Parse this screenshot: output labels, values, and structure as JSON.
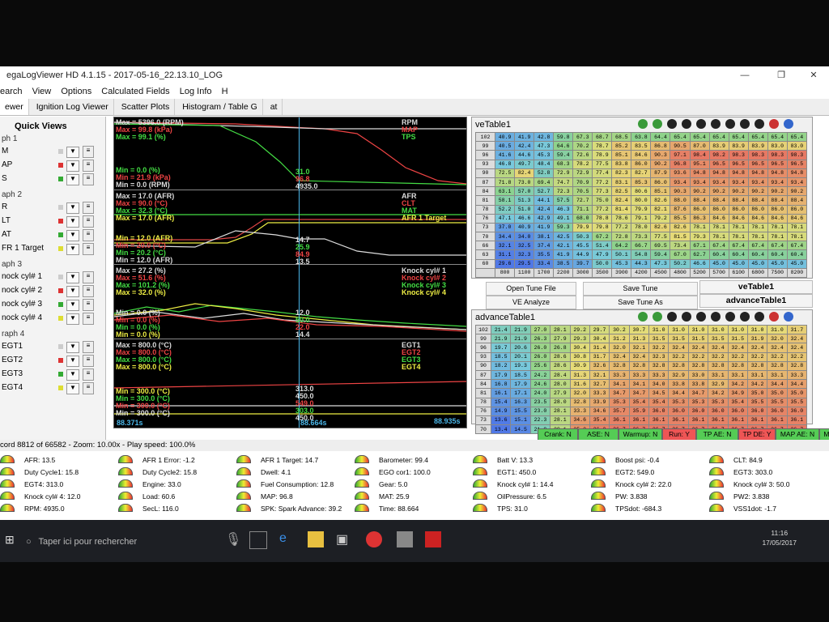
{
  "window": {
    "title": "egaLogViewer HD 4.1.15 - 2017-05-16_22.13.10_LOG",
    "min": "—",
    "max": "❐",
    "close": "✕"
  },
  "menu": [
    "earch",
    "View",
    "Options",
    "Calculated Fields",
    "Log Info",
    "H"
  ],
  "tabs": [
    "ewer",
    "Ignition Log Viewer",
    "Scatter Plots",
    "Histogram / Table G",
    "at"
  ],
  "quickviews": {
    "title": "Quick Views",
    "groups": [
      {
        "label": "ph 1",
        "items": [
          {
            "label": "M",
            "color": "#cccccc"
          },
          {
            "label": "AP",
            "color": "#dd3333"
          },
          {
            "label": "S",
            "color": "#33aa33"
          }
        ]
      },
      {
        "label": "aph 2",
        "items": [
          {
            "label": "R",
            "color": "#cccccc"
          },
          {
            "label": "LT",
            "color": "#dd3333"
          },
          {
            "label": "AT",
            "color": "#33aa33"
          },
          {
            "label": "FR 1 Target",
            "color": "#dddd33"
          }
        ]
      },
      {
        "label": "aph 3",
        "items": [
          {
            "label": "nock cyl# 1",
            "color": "#cccccc"
          },
          {
            "label": "nock cyl# 2",
            "color": "#dd3333"
          },
          {
            "label": "nock cyl# 3",
            "color": "#33aa33"
          },
          {
            "label": "nock cyl# 4",
            "color": "#dddd33"
          }
        ]
      },
      {
        "label": "raph 4",
        "items": [
          {
            "label": "EGT1",
            "color": "#cccccc"
          },
          {
            "label": "EGT2",
            "color": "#dd3333"
          },
          {
            "label": "EGT3",
            "color": "#33aa33"
          },
          {
            "label": "EGT4",
            "color": "#dddd33"
          }
        ]
      }
    ]
  },
  "graph": {
    "p1": {
      "max": [
        "Max = 5396.0 (RPM)",
        "Max = 99.8 (kPa)",
        "Max = 99.1 (%)"
      ],
      "min": [
        "Min = 0.0 (%)",
        "Min = 21.9 (kPa)",
        "Min = 0.0 (RPM)"
      ],
      "legend": [
        "RPM",
        "MAP",
        "TPS"
      ],
      "cursor": [
        "31.0",
        "96.8",
        "4935.0"
      ]
    },
    "p2": {
      "max": [
        "Max = 17.0 (AFR)",
        "Max = 90.0 (°C)",
        "Max = 32.3 (°C)",
        "Max = 17.0 (AFR)"
      ],
      "min": [
        "Min = 12.0 (AFR)",
        "Min = 20.0 (°C)",
        "Min = 20.2 (°C)",
        "Min = 12.0 (AFR)"
      ],
      "legend": [
        "AFR",
        "CLT",
        "MAT",
        "AFR 1 Target"
      ],
      "cursor": [
        "14.7",
        "25.9",
        "84.9",
        "13.5"
      ]
    },
    "p3": {
      "max": [
        "Max = 27.2 (%)",
        "Max = 51.6 (%)",
        "Max = 101.2 (%)",
        "Max = 32.0 (%)"
      ],
      "min": [
        "Min = 0.0 (%)",
        "Min = 0.0 (%)",
        "Min = 0.0 (%)",
        "Min = 0.0 (%)"
      ],
      "legend": [
        "Knock cyl# 1",
        "Knock cyl# 2",
        "Knock cyl# 3",
        "Knock cyl# 4"
      ],
      "cursor": [
        "12.0",
        "50.0",
        "22.0",
        "14.4"
      ]
    },
    "p4": {
      "max": [
        "Max = 800.0 (°C)",
        "Max = 800.0 (°C)",
        "Max = 800.0 (°C)",
        "Max = 800.0 (°C)"
      ],
      "min": [
        "Min = 300.0 (°C)",
        "Min = 300.0 (°C)",
        "Min = 300.0 (°C)",
        "Min = 300.0 (°C)"
      ],
      "legend": [
        "EGT1",
        "EGT2",
        "EGT3",
        "EGT4"
      ],
      "cursor": [
        "313.0",
        "450.0",
        "549.0",
        "303.0",
        "450.0"
      ]
    },
    "time_left": "88.371s",
    "time_cursor": "88.664s",
    "time_right": "88.935s"
  },
  "veTable": {
    "title": "veTable1",
    "rows": [
      "102",
      "99",
      "96",
      "93",
      "90",
      "87",
      "84",
      "81",
      "78",
      "76",
      "73",
      "70",
      "66",
      "63",
      "60"
    ],
    "cols": [
      "800",
      "1100",
      "1700",
      "2200",
      "3000",
      "3500",
      "3900",
      "4200",
      "4500",
      "4800",
      "5200",
      "5700",
      "6100",
      "6800",
      "7500",
      "8200"
    ],
    "cells": [
      [
        "40.9",
        "41.9",
        "42.8",
        "59.8",
        "67.3",
        "68.7",
        "68.5",
        "63.8",
        "64.4",
        "65.4",
        "65.4",
        "65.4",
        "65.4",
        "65.4",
        "65.4",
        "65.4"
      ],
      [
        "40.5",
        "42.4",
        "47.3",
        "64.6",
        "70.2",
        "78.7",
        "85.2",
        "83.5",
        "86.8",
        "90.5",
        "87.0",
        "83.9",
        "83.9",
        "83.9",
        "83.0",
        "83.0"
      ],
      [
        "41.6",
        "44.6",
        "45.3",
        "59.4",
        "72.6",
        "78.9",
        "85.1",
        "84.6",
        "90.3",
        "97.1",
        "98.4",
        "98.2",
        "98.3",
        "98.3",
        "98.3",
        "98.3"
      ],
      [
        "46.8",
        "49.7",
        "48.4",
        "68.3",
        "78.2",
        "77.5",
        "83.8",
        "86.0",
        "90.2",
        "96.8",
        "95.1",
        "96.5",
        "96.5",
        "96.5",
        "96.5",
        "96.5"
      ],
      [
        "72.5",
        "82.4",
        "52.8",
        "72.9",
        "72.9",
        "77.4",
        "82.3",
        "82.7",
        "87.9",
        "93.6",
        "94.8",
        "94.8",
        "94.8",
        "94.8",
        "94.8",
        "94.8"
      ],
      [
        "71.8",
        "73.0",
        "69.4",
        "74.7",
        "70.9",
        "77.2",
        "83.1",
        "85.3",
        "86.0",
        "93.4",
        "93.4",
        "93.4",
        "93.4",
        "93.4",
        "93.4",
        "93.4"
      ],
      [
        "63.1",
        "57.0",
        "52.7",
        "72.3",
        "70.5",
        "77.3",
        "82.5",
        "80.6",
        "85.1",
        "90.3",
        "90.2",
        "90.2",
        "90.2",
        "90.2",
        "90.2",
        "90.2"
      ],
      [
        "58.1",
        "51.3",
        "44.1",
        "57.5",
        "72.7",
        "75.0",
        "82.4",
        "80.0",
        "82.6",
        "88.0",
        "88.4",
        "88.4",
        "88.4",
        "88.4",
        "88.4",
        "88.4"
      ],
      [
        "52.2",
        "51.0",
        "42.4",
        "46.3",
        "71.1",
        "77.2",
        "81.4",
        "79.9",
        "82.1",
        "87.6",
        "86.0",
        "86.0",
        "86.0",
        "86.0",
        "86.0",
        "86.0"
      ],
      [
        "47.1",
        "46.6",
        "42.9",
        "49.1",
        "68.0",
        "78.8",
        "78.6",
        "79.1",
        "79.2",
        "85.5",
        "86.3",
        "84.6",
        "84.6",
        "84.6",
        "84.6",
        "84.6"
      ],
      [
        "37.0",
        "40.9",
        "41.9",
        "59.3",
        "79.9",
        "79.8",
        "77.2",
        "78.0",
        "82.6",
        "82.6",
        "78.1",
        "78.1",
        "78.1",
        "78.1",
        "78.1",
        "78.1"
      ],
      [
        "34.4",
        "34.0",
        "38.1",
        "42.5",
        "50.3",
        "67.2",
        "72.8",
        "73.3",
        "77.5",
        "81.5",
        "79.3",
        "78.1",
        "78.1",
        "78.1",
        "78.1",
        "78.1"
      ],
      [
        "32.1",
        "32.5",
        "37.4",
        "42.1",
        "45.5",
        "51.4",
        "64.2",
        "66.7",
        "69.5",
        "73.4",
        "67.1",
        "67.4",
        "67.4",
        "67.4",
        "67.4",
        "67.4"
      ],
      [
        "31.1",
        "32.3",
        "35.5",
        "41.9",
        "44.9",
        "47.9",
        "50.1",
        "54.8",
        "59.4",
        "67.0",
        "62.7",
        "60.4",
        "60.4",
        "60.4",
        "60.4",
        "60.4"
      ],
      [
        "29.6",
        "29.5",
        "33.4",
        "38.5",
        "39.7",
        "50.0",
        "45.3",
        "44.3",
        "47.3",
        "50.2",
        "46.6",
        "45.0",
        "45.0",
        "45.0",
        "45.0",
        "45.0"
      ]
    ]
  },
  "buttons": {
    "open_tune": "Open Tune File",
    "save_tune": "Save Tune",
    "ve_analyze": "VE Analyze",
    "save_tune_as": "Save Tune As",
    "tab_ve": "veTable1",
    "tab_adv": "advanceTable1"
  },
  "advTable": {
    "title": "advanceTable1",
    "rows": [
      "102",
      "99",
      "96",
      "93",
      "90",
      "87",
      "84",
      "81",
      "78",
      "76",
      "73",
      "70"
    ],
    "cells": [
      [
        "21.4",
        "21.9",
        "27.0",
        "28.1",
        "29.2",
        "29.7",
        "30.2",
        "30.7",
        "31.0",
        "31.0",
        "31.0",
        "31.0",
        "31.0",
        "31.0",
        "31.0",
        "31.7"
      ],
      [
        "21.9",
        "21.9",
        "26.3",
        "27.9",
        "29.3",
        "30.4",
        "31.2",
        "31.3",
        "31.5",
        "31.5",
        "31.5",
        "31.5",
        "31.5",
        "31.9",
        "32.0",
        "32.4"
      ],
      [
        "19.7",
        "20.6",
        "26.0",
        "26.8",
        "30.4",
        "31.4",
        "32.0",
        "32.1",
        "32.2",
        "32.4",
        "32.4",
        "32.4",
        "32.4",
        "32.4",
        "32.4",
        "32.4"
      ],
      [
        "18.5",
        "20.1",
        "26.0",
        "28.6",
        "30.8",
        "31.7",
        "32.4",
        "32.4",
        "32.3",
        "32.2",
        "32.2",
        "32.2",
        "32.2",
        "32.2",
        "32.2",
        "32.2"
      ],
      [
        "18.2",
        "19.3",
        "25.6",
        "28.6",
        "30.9",
        "32.6",
        "32.8",
        "32.8",
        "32.8",
        "32.8",
        "32.8",
        "32.8",
        "32.8",
        "32.8",
        "32.8",
        "32.8"
      ],
      [
        "17.9",
        "18.5",
        "24.2",
        "28.4",
        "31.3",
        "32.1",
        "33.3",
        "33.3",
        "33.3",
        "32.9",
        "33.0",
        "33.1",
        "33.1",
        "33.1",
        "33.1",
        "33.3"
      ],
      [
        "16.8",
        "17.9",
        "24.6",
        "28.0",
        "31.6",
        "32.7",
        "34.1",
        "34.1",
        "34.0",
        "33.8",
        "33.8",
        "32.9",
        "34.2",
        "34.2",
        "34.4",
        "34.4"
      ],
      [
        "16.1",
        "17.1",
        "24.0",
        "27.9",
        "32.0",
        "33.3",
        "34.7",
        "34.7",
        "34.5",
        "34.4",
        "34.7",
        "34.2",
        "34.9",
        "35.0",
        "35.0",
        "35.0"
      ],
      [
        "15.4",
        "16.3",
        "23.5",
        "28.0",
        "32.8",
        "33.9",
        "35.3",
        "35.4",
        "35.4",
        "35.3",
        "35.3",
        "35.3",
        "35.4",
        "35.5",
        "35.5",
        "35.5"
      ],
      [
        "14.9",
        "15.5",
        "23.0",
        "28.1",
        "33.3",
        "34.6",
        "35.7",
        "35.9",
        "36.0",
        "36.0",
        "36.0",
        "36.0",
        "36.0",
        "36.0",
        "36.0",
        "36.0"
      ],
      [
        "13.6",
        "15.1",
        "22.3",
        "28.1",
        "34.6",
        "35.4",
        "36.1",
        "36.1",
        "36.1",
        "36.1",
        "36.1",
        "36.1",
        "36.1",
        "36.1",
        "36.1",
        "36.1"
      ],
      [
        "13.4",
        "14.5",
        "21.9",
        "28.1",
        "35.2",
        "36.2",
        "36.7",
        "36.7",
        "36.7",
        "36.7",
        "36.7",
        "36.7",
        "36.7",
        "36.7",
        "36.7",
        "36.7"
      ]
    ]
  },
  "indicators": [
    {
      "label": "Crank: N",
      "color": "#55cc55"
    },
    {
      "label": "ASE: N",
      "color": "#55cc55"
    },
    {
      "label": "Warmup: N",
      "color": "#55cc55"
    },
    {
      "label": "Run: Y",
      "color": "#ee5555"
    },
    {
      "label": "TP AE: N",
      "color": "#55cc55"
    },
    {
      "label": "TP DE: Y",
      "color": "#ee5555"
    },
    {
      "label": "MAP AE: N",
      "color": "#55cc55"
    },
    {
      "label": "MAP DE: N",
      "color": "#55cc55"
    }
  ],
  "status": "cord 8812 of 66582 - Zoom: 10.00x - Play speed: 100.0%",
  "gauges": [
    [
      "AFR: 13.5",
      "Duty Cycle1: 15.8",
      "EGT4: 313.0",
      "Knock cyl# 4: 12.0",
      "RPM: 4935.0"
    ],
    [
      "AFR 1 Error: -1.2",
      "Duty Cycle2: 15.8",
      "Engine: 33.0",
      "Load: 60.6",
      "SecL: 116.0"
    ],
    [
      "AFR 1 Target: 14.7",
      "Dwell: 4.1",
      "Fuel Consumption: 12.8",
      "MAP: 96.8",
      "SPK: Spark Advance: 39.2"
    ],
    [
      "Barometer: 99.4",
      "EGO cor1: 100.0",
      "Gear: 5.0",
      "MAT: 25.9",
      "Time: 88.664"
    ],
    [
      "Batt V: 13.3",
      "EGT1: 450.0",
      "Knock cyl# 1: 14.4",
      "OilPressure: 6.5",
      "TPS: 31.0"
    ],
    [
      "Boost psi: -0.4",
      "EGT2: 549.0",
      "Knock cyl# 2: 22.0",
      "PW: 3.838",
      "TPSdot: -684.3"
    ],
    [
      "CLT: 84.9",
      "EGT3: 303.0",
      "Knock cyl# 3: 50.0",
      "PW2: 3.838",
      "VSS1dot: -1.7"
    ]
  ],
  "taskbar": {
    "search_placeholder": "Taper ici pour rechercher",
    "time": "11:16",
    "date": "17/05/2017"
  }
}
